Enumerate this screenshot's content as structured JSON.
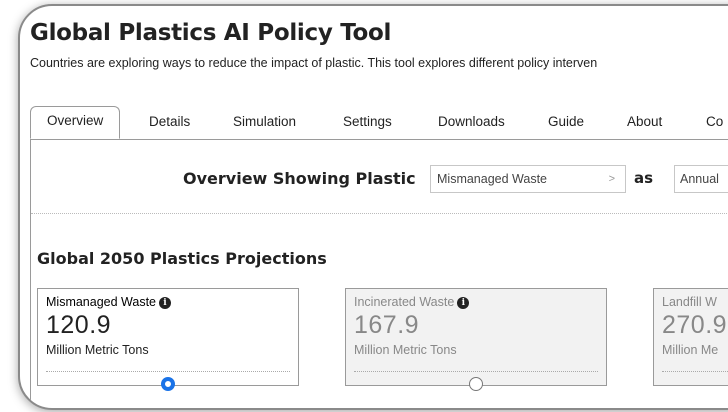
{
  "app": {
    "title": "Global Plastics AI Policy Tool",
    "description": "Countries are exploring ways to reduce the impact of plastic. This tool explores different policy interven"
  },
  "tabs": [
    {
      "label": "Overview",
      "active": true
    },
    {
      "label": "Details"
    },
    {
      "label": "Simulation"
    },
    {
      "label": "Settings"
    },
    {
      "label": "Downloads"
    },
    {
      "label": "Guide"
    },
    {
      "label": "About"
    },
    {
      "label": "Co"
    }
  ],
  "filters": {
    "prefix": "Overview Showing Plastic",
    "metric_select": "Mismanaged Waste",
    "metric_chevron": ">",
    "as_label": "as",
    "mode_select": "Annual"
  },
  "section": {
    "heading": "Global 2050 Plastics Projections"
  },
  "cards": [
    {
      "title": "Mismanaged Waste",
      "value": "120.9",
      "unit": "Million Metric Tons",
      "selected": true
    },
    {
      "title": "Incinerated Waste",
      "value": "167.9",
      "unit": "Million Metric Tons",
      "selected": false
    },
    {
      "title": "Landfill W",
      "value": "270.9",
      "unit": "Million Me",
      "selected": false
    }
  ],
  "colors": {
    "accent": "#1a73e8",
    "border": "#9a9a9a",
    "dim_card": "#f2f2f2"
  }
}
